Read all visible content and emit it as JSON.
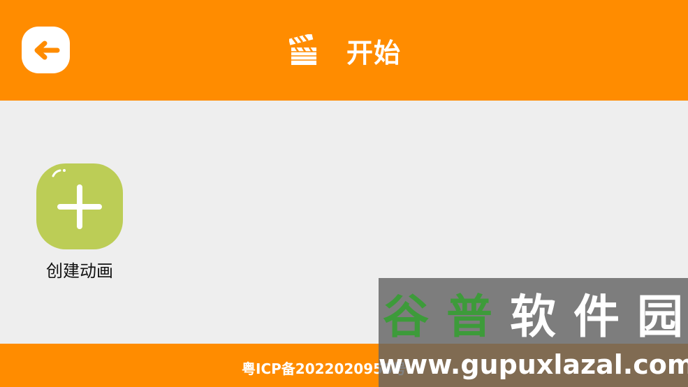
{
  "header": {
    "title": "开始",
    "back_icon": "arrow-left-icon",
    "title_icon": "clapperboard-icon",
    "color": "#ff8c00"
  },
  "main": {
    "create_label": "创建动画",
    "create_icon": "plus-icon",
    "create_color": "#bccd56",
    "background": "#eeeeee"
  },
  "footer": {
    "icp": "粤ICP备2022020955号"
  },
  "watermark": {
    "title_chars": [
      "谷",
      "普",
      "软",
      "件",
      "园"
    ],
    "url": "www.gupuxlazal.com"
  }
}
